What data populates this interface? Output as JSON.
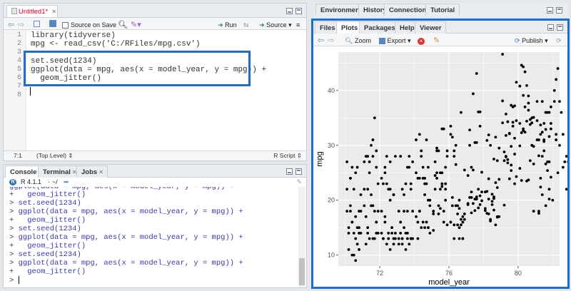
{
  "source": {
    "file_tab": "Untitled1*",
    "source_on_save_label": "Source on Save",
    "run_label": "Run",
    "source_label": "Source",
    "line_numbers": [
      "1",
      "2",
      "3",
      "4",
      "5",
      "6",
      "7",
      "8"
    ],
    "code_lines": [
      "library(tidyverse)",
      "mpg <- read_csv('C:/RFiles/mpg.csv')",
      "",
      "set.seed(1234)",
      "ggplot(data = mpg, aes(x = model_year, y = mpg)) +",
      "  geom_jitter()",
      "",
      ""
    ],
    "cursor_position": "7:1",
    "scope": "(Top Level)",
    "file_type": "R Script"
  },
  "console": {
    "tabs": [
      "Console",
      "Terminal",
      "Jobs"
    ],
    "r_version": "R 4.1.1",
    "working_dir": "~/",
    "lines": [
      {
        "prompt": "+ ",
        "text": "  geom_jitter()"
      },
      {
        "prompt": "> ",
        "text": "set.seed(1234)"
      },
      {
        "prompt": "> ",
        "text": "ggplot(data = mpg, aes(x = model_year, y = mpg)) +"
      },
      {
        "prompt": "+ ",
        "text": "  geom_jitter()"
      },
      {
        "prompt": "> ",
        "text": "set.seed(1234)"
      },
      {
        "prompt": "> ",
        "text": "ggplot(data = mpg, aes(x = model_year, y = mpg)) +"
      },
      {
        "prompt": "+ ",
        "text": "  geom_jitter()"
      },
      {
        "prompt": "> ",
        "text": "set.seed(1234)"
      },
      {
        "prompt": "> ",
        "text": "ggplot(data = mpg, aes(x = model_year, y = mpg)) +"
      },
      {
        "prompt": "+ ",
        "text": "  geom_jitter()"
      },
      {
        "prompt": "> ",
        "text": ""
      }
    ]
  },
  "env": {
    "tabs": [
      "Environment",
      "History",
      "Connections",
      "Tutorial"
    ]
  },
  "viewer": {
    "tabs": [
      "Files",
      "Plots",
      "Packages",
      "Help",
      "Viewer"
    ],
    "zoom_label": "Zoom",
    "export_label": "Export",
    "publish_label": "Publish"
  },
  "chart_data": {
    "type": "scatter",
    "xlabel": "model_year",
    "ylabel": "mpg",
    "xlim": [
      69.6,
      82.4
    ],
    "ylim": [
      8,
      47
    ],
    "xticks": [
      72,
      76,
      80
    ],
    "yticks": [
      10,
      20,
      30,
      40
    ],
    "grid": true,
    "points": [
      [
        70.1,
        18
      ],
      [
        70.2,
        15
      ],
      [
        70.3,
        18
      ],
      [
        70.4,
        16
      ],
      [
        70.6,
        17
      ],
      [
        70.7,
        15
      ],
      [
        70.2,
        14
      ],
      [
        70.5,
        14
      ],
      [
        70.8,
        15
      ],
      [
        70.3,
        24
      ],
      [
        70.5,
        22
      ],
      [
        70.8,
        18
      ],
      [
        70.9,
        21
      ],
      [
        70.1,
        27
      ],
      [
        70.4,
        26
      ],
      [
        70.6,
        25
      ],
      [
        70.3,
        24
      ],
      [
        70.7,
        26
      ],
      [
        70.9,
        14
      ],
      [
        70.4,
        10
      ],
      [
        70.6,
        9
      ],
      [
        70.8,
        11
      ],
      [
        70.2,
        11
      ],
      [
        70.5,
        10
      ],
      [
        70.7,
        12
      ],
      [
        70.9,
        18
      ],
      [
        70.3,
        19
      ],
      [
        70.6,
        13
      ],
      [
        70.8,
        14
      ],
      [
        70.1,
        22
      ],
      [
        71.1,
        27
      ],
      [
        71.3,
        28
      ],
      [
        71.4,
        25
      ],
      [
        71.6,
        19
      ],
      [
        71.8,
        16
      ],
      [
        71.2,
        17
      ],
      [
        71.5,
        19
      ],
      [
        71.7,
        18
      ],
      [
        71.9,
        14
      ],
      [
        71.3,
        14
      ],
      [
        71.6,
        13
      ],
      [
        71.8,
        14
      ],
      [
        71.2,
        12
      ],
      [
        71.4,
        13
      ],
      [
        71.7,
        13
      ],
      [
        71.9,
        18
      ],
      [
        71.1,
        22
      ],
      [
        71.5,
        21
      ],
      [
        71.8,
        26
      ],
      [
        71.3,
        22
      ],
      [
        71.6,
        28
      ],
      [
        71.9,
        23
      ],
      [
        71.2,
        28
      ],
      [
        71.4,
        27
      ],
      [
        71.6,
        31
      ],
      [
        71.8,
        29
      ],
      [
        71.7,
        35
      ],
      [
        71.5,
        30
      ],
      [
        71.1,
        19
      ],
      [
        71.3,
        15
      ],
      [
        72.1,
        24
      ],
      [
        72.3,
        25
      ],
      [
        72.4,
        23
      ],
      [
        72.6,
        20
      ],
      [
        72.8,
        21
      ],
      [
        72.2,
        13
      ],
      [
        72.5,
        14
      ],
      [
        72.7,
        15
      ],
      [
        72.9,
        14
      ],
      [
        72.3,
        17
      ],
      [
        72.6,
        11
      ],
      [
        72.8,
        12
      ],
      [
        72.2,
        13
      ],
      [
        72.4,
        12
      ],
      [
        72.7,
        15
      ],
      [
        72.9,
        13
      ],
      [
        72.1,
        18
      ],
      [
        72.5,
        22
      ],
      [
        72.8,
        21
      ],
      [
        72.3,
        26
      ],
      [
        72.6,
        22
      ],
      [
        72.9,
        28
      ],
      [
        72.2,
        23
      ],
      [
        72.4,
        28
      ],
      [
        72.6,
        27
      ],
      [
        72.8,
        13
      ],
      [
        72.7,
        14
      ],
      [
        72.5,
        13
      ],
      [
        72.1,
        14
      ],
      [
        72.3,
        16
      ],
      [
        73.1,
        18
      ],
      [
        73.3,
        22
      ],
      [
        73.4,
        21
      ],
      [
        73.6,
        26
      ],
      [
        73.8,
        22
      ],
      [
        73.2,
        28
      ],
      [
        73.5,
        23
      ],
      [
        73.7,
        28
      ],
      [
        73.9,
        27
      ],
      [
        73.3,
        13
      ],
      [
        73.6,
        14
      ],
      [
        73.8,
        13
      ],
      [
        73.2,
        14
      ],
      [
        73.4,
        15
      ],
      [
        73.7,
        12
      ],
      [
        73.9,
        13
      ],
      [
        73.1,
        13
      ],
      [
        73.5,
        14
      ],
      [
        73.8,
        13
      ],
      [
        73.3,
        12
      ],
      [
        73.6,
        13
      ],
      [
        73.9,
        18
      ],
      [
        73.2,
        16
      ],
      [
        73.4,
        18
      ],
      [
        73.6,
        18
      ],
      [
        73.8,
        23
      ],
      [
        73.7,
        26
      ],
      [
        73.5,
        11
      ],
      [
        73.1,
        12
      ],
      [
        73.3,
        13
      ],
      [
        74.1,
        31
      ],
      [
        74.3,
        32
      ],
      [
        74.4,
        28
      ],
      [
        74.6,
        24
      ],
      [
        74.8,
        26
      ],
      [
        74.2,
        24
      ],
      [
        74.5,
        26
      ],
      [
        74.7,
        31
      ],
      [
        74.9,
        19
      ],
      [
        74.3,
        18
      ],
      [
        74.6,
        15
      ],
      [
        74.8,
        15
      ],
      [
        74.2,
        16
      ],
      [
        74.4,
        15
      ],
      [
        74.7,
        16
      ],
      [
        74.9,
        14
      ],
      [
        74.1,
        17
      ],
      [
        74.5,
        16
      ],
      [
        74.8,
        15
      ],
      [
        74.3,
        18
      ],
      [
        74.6,
        21
      ],
      [
        74.9,
        20
      ],
      [
        74.2,
        13
      ],
      [
        74.4,
        29
      ],
      [
        74.6,
        23
      ],
      [
        74.8,
        20
      ],
      [
        74.7,
        23
      ],
      [
        74.5,
        24
      ],
      [
        74.1,
        25
      ],
      [
        74.3,
        24
      ],
      [
        75.1,
        18
      ],
      [
        75.3,
        29
      ],
      [
        75.4,
        19
      ],
      [
        75.6,
        23
      ],
      [
        75.8,
        23
      ],
      [
        75.2,
        22
      ],
      [
        75.5,
        25
      ],
      [
        75.7,
        33
      ],
      [
        75.9,
        28
      ],
      [
        75.3,
        25
      ],
      [
        75.6,
        25
      ],
      [
        75.8,
        26
      ],
      [
        75.2,
        27
      ],
      [
        75.4,
        17.5
      ],
      [
        75.7,
        16
      ],
      [
        75.9,
        15.5
      ],
      [
        75.1,
        14.5
      ],
      [
        75.5,
        22
      ],
      [
        75.8,
        22
      ],
      [
        75.3,
        24
      ],
      [
        75.6,
        22.5
      ],
      [
        75.9,
        29
      ],
      [
        75.2,
        24.5
      ],
      [
        75.4,
        29
      ],
      [
        75.6,
        33
      ],
      [
        75.8,
        20
      ],
      [
        75.7,
        18
      ],
      [
        75.5,
        18.5
      ],
      [
        75.1,
        17.5
      ],
      [
        75.3,
        29.5
      ],
      [
        76.1,
        32
      ],
      [
        76.3,
        28
      ],
      [
        76.4,
        26.5
      ],
      [
        76.6,
        20
      ],
      [
        76.8,
        13
      ],
      [
        76.2,
        19
      ],
      [
        76.5,
        19
      ],
      [
        76.7,
        16.5
      ],
      [
        76.9,
        16.5
      ],
      [
        76.3,
        13
      ],
      [
        76.6,
        13
      ],
      [
        76.8,
        13
      ],
      [
        76.2,
        31.5
      ],
      [
        76.4,
        30
      ],
      [
        76.7,
        36
      ],
      [
        76.9,
        25.5
      ],
      [
        76.1,
        33.5
      ],
      [
        76.5,
        17.5
      ],
      [
        76.8,
        17
      ],
      [
        76.3,
        15.5
      ],
      [
        76.6,
        15
      ],
      [
        76.9,
        17.5
      ],
      [
        76.2,
        20.5
      ],
      [
        76.4,
        19
      ],
      [
        76.6,
        18.5
      ],
      [
        76.8,
        16
      ],
      [
        76.7,
        15.5
      ],
      [
        76.5,
        15.5
      ],
      [
        76.1,
        16
      ],
      [
        76.3,
        29
      ],
      [
        77.1,
        24.5
      ],
      [
        77.3,
        26
      ],
      [
        77.4,
        25.5
      ],
      [
        77.6,
        30.5
      ],
      [
        77.8,
        33.5
      ],
      [
        77.2,
        30
      ],
      [
        77.5,
        30.5
      ],
      [
        77.7,
        22
      ],
      [
        77.9,
        21.5
      ],
      [
        77.3,
        21.5
      ],
      [
        77.6,
        43.1
      ],
      [
        77.8,
        36.1
      ],
      [
        77.2,
        32.8
      ],
      [
        77.4,
        39.4
      ],
      [
        77.7,
        36.1
      ],
      [
        77.9,
        19.9
      ],
      [
        77.1,
        19.4
      ],
      [
        77.5,
        20.2
      ],
      [
        77.8,
        19.2
      ],
      [
        77.3,
        20.5
      ],
      [
        77.6,
        20.2
      ],
      [
        77.9,
        25.1
      ],
      [
        77.2,
        20.5
      ],
      [
        77.4,
        19.4
      ],
      [
        77.6,
        20.6
      ],
      [
        77.8,
        20.8
      ],
      [
        77.7,
        18.6
      ],
      [
        77.5,
        18.1
      ],
      [
        77.1,
        19.2
      ],
      [
        77.3,
        17.7
      ],
      [
        78.1,
        18.1
      ],
      [
        78.3,
        17.5
      ],
      [
        78.4,
        30
      ],
      [
        78.6,
        27.5
      ],
      [
        78.8,
        27.2
      ],
      [
        78.2,
        30.9
      ],
      [
        78.5,
        21.1
      ],
      [
        78.7,
        23.2
      ],
      [
        78.9,
        23.8
      ],
      [
        78.3,
        23.9
      ],
      [
        78.6,
        20.3
      ],
      [
        78.8,
        17
      ],
      [
        78.2,
        21.6
      ],
      [
        78.4,
        16.2
      ],
      [
        78.7,
        31.5
      ],
      [
        78.9,
        29.5
      ],
      [
        78.1,
        21.5
      ],
      [
        78.5,
        19.8
      ],
      [
        78.8,
        22.3
      ],
      [
        78.3,
        20.2
      ],
      [
        78.6,
        20.6
      ],
      [
        78.9,
        17
      ],
      [
        78.2,
        17.6
      ],
      [
        78.4,
        16.5
      ],
      [
        78.6,
        18.2
      ],
      [
        78.8,
        16.9
      ],
      [
        78.7,
        15.5
      ],
      [
        78.5,
        19.2
      ],
      [
        78.1,
        18.5
      ],
      [
        78.3,
        31.9
      ],
      [
        79.1,
        34.1
      ],
      [
        79.3,
        35.7
      ],
      [
        79.4,
        27.4
      ],
      [
        79.6,
        25.4
      ],
      [
        79.8,
        23
      ],
      [
        79.2,
        27.2
      ],
      [
        79.5,
        23.9
      ],
      [
        79.7,
        34.2
      ],
      [
        79.9,
        34.5
      ],
      [
        79.3,
        31.8
      ],
      [
        79.6,
        37.3
      ],
      [
        79.8,
        28.4
      ],
      [
        79.2,
        28.8
      ],
      [
        79.4,
        26.8
      ],
      [
        79.7,
        33.5
      ],
      [
        79.9,
        41.5
      ],
      [
        79.1,
        38.1
      ],
      [
        79.5,
        32.1
      ],
      [
        79.8,
        37.2
      ],
      [
        79.3,
        28
      ],
      [
        79.6,
        26.4
      ],
      [
        79.9,
        24.3
      ],
      [
        79.2,
        19.1
      ],
      [
        79.4,
        34.3
      ],
      [
        79.6,
        29.8
      ],
      [
        79.8,
        31.3
      ],
      [
        79.7,
        37
      ],
      [
        79.5,
        32.2
      ],
      [
        79.1,
        46.6
      ],
      [
        79.3,
        27.9
      ],
      [
        80.1,
        40.8
      ],
      [
        80.3,
        44.3
      ],
      [
        80.4,
        43.4
      ],
      [
        80.6,
        36.4
      ],
      [
        80.8,
        30
      ],
      [
        80.2,
        44.6
      ],
      [
        80.5,
        40.9
      ],
      [
        80.7,
        33.8
      ],
      [
        80.9,
        29.8
      ],
      [
        80.3,
        32.7
      ],
      [
        80.6,
        23.7
      ],
      [
        80.8,
        35
      ],
      [
        80.2,
        23.6
      ],
      [
        80.4,
        32.4
      ],
      [
        80.7,
        27.2
      ],
      [
        80.9,
        26.6
      ],
      [
        80.1,
        25.8
      ],
      [
        80.5,
        23.5
      ],
      [
        80.8,
        30
      ],
      [
        80.3,
        39.1
      ],
      [
        80.6,
        39
      ],
      [
        80.9,
        35.1
      ],
      [
        80.2,
        32.3
      ],
      [
        80.4,
        37
      ],
      [
        80.6,
        37.7
      ],
      [
        80.8,
        34.1
      ],
      [
        80.7,
        34.7
      ],
      [
        80.5,
        34.4
      ],
      [
        80.1,
        29.9
      ],
      [
        80.3,
        33
      ],
      [
        81.1,
        34.5
      ],
      [
        81.3,
        33.7
      ],
      [
        81.4,
        32.4
      ],
      [
        81.6,
        32.9
      ],
      [
        81.8,
        31.6
      ],
      [
        81.2,
        28.1
      ],
      [
        81.5,
        30.7
      ],
      [
        81.7,
        25.4
      ],
      [
        81.9,
        24.2
      ],
      [
        81.3,
        22.4
      ],
      [
        81.6,
        26.6
      ],
      [
        81.8,
        20.2
      ],
      [
        81.2,
        17.6
      ],
      [
        81.4,
        28
      ],
      [
        81.7,
        27
      ],
      [
        81.9,
        34
      ],
      [
        81.1,
        31
      ],
      [
        81.5,
        29
      ],
      [
        81.8,
        27
      ],
      [
        81.3,
        24
      ],
      [
        81.6,
        36
      ],
      [
        81.9,
        37
      ],
      [
        81.2,
        31
      ],
      [
        81.4,
        38
      ],
      [
        81.6,
        36
      ],
      [
        81.8,
        36
      ],
      [
        81.7,
        36
      ],
      [
        81.5,
        34
      ],
      [
        81.1,
        38
      ],
      [
        81.3,
        32
      ],
      [
        82.1,
        38
      ],
      [
        82.3,
        25
      ],
      [
        82.4,
        38
      ],
      [
        82.6,
        26
      ],
      [
        82.8,
        22
      ],
      [
        82.2,
        32
      ],
      [
        82.5,
        36
      ],
      [
        82.7,
        27
      ],
      [
        82.9,
        27
      ],
      [
        82.3,
        44
      ],
      [
        82.6,
        32
      ],
      [
        82.8,
        28
      ],
      [
        82.2,
        31
      ],
      [
        82.4,
        30
      ],
      [
        82.1,
        40
      ],
      [
        82.2,
        42
      ],
      [
        81.8,
        22
      ],
      [
        81.6,
        19
      ],
      [
        81.4,
        21
      ],
      [
        82.0,
        20
      ],
      [
        81.2,
        18
      ],
      [
        80.9,
        18
      ],
      [
        81.5,
        31
      ],
      [
        81.9,
        33
      ],
      [
        80.1,
        34
      ]
    ]
  }
}
